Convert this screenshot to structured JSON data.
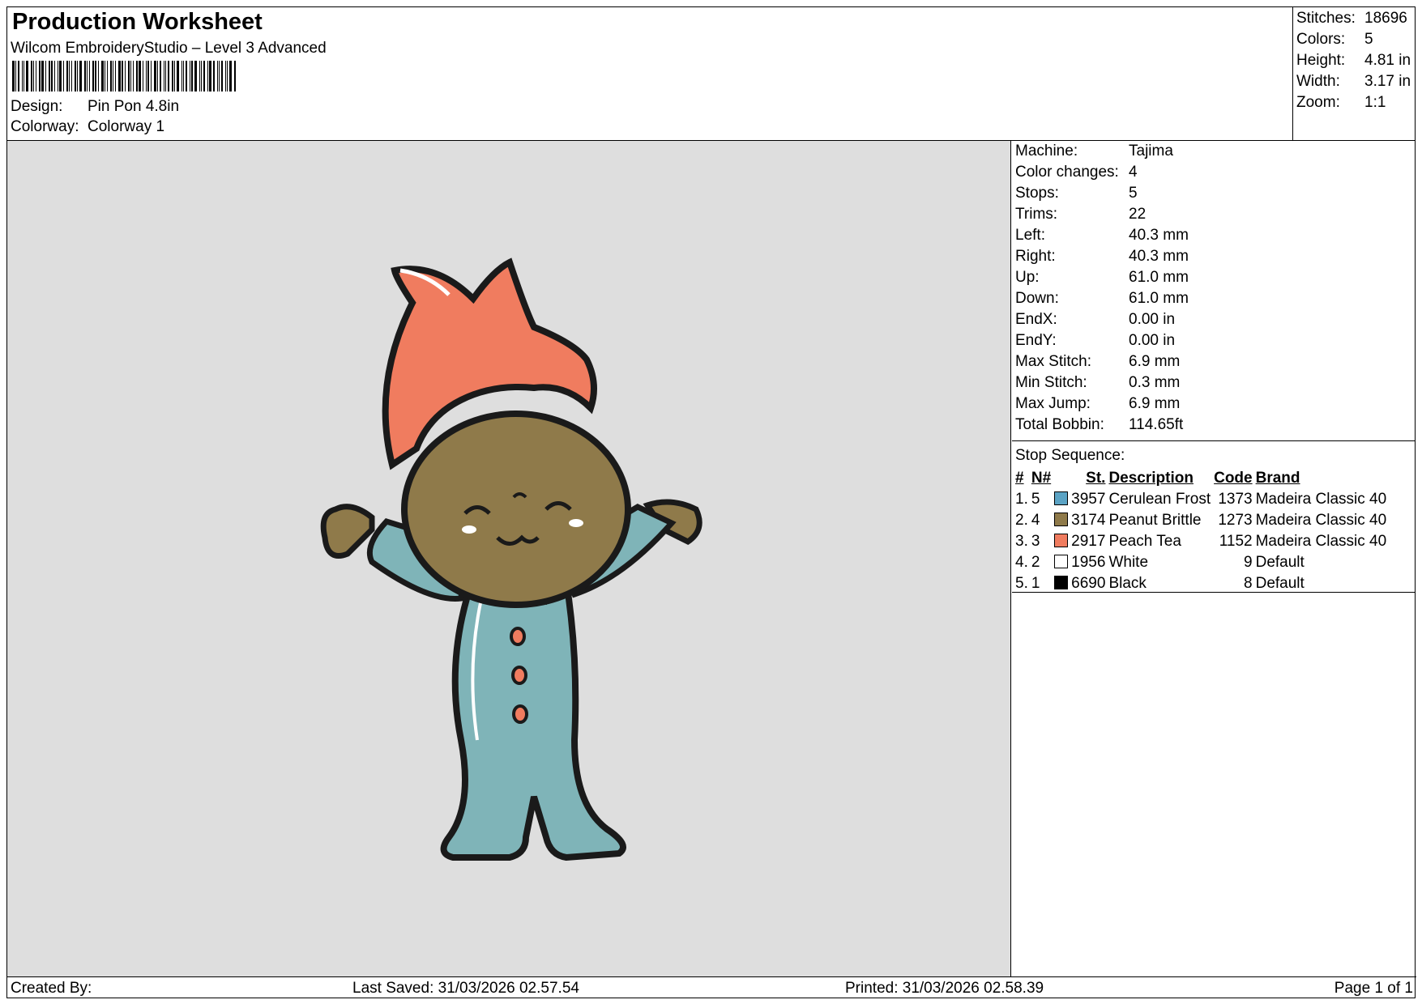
{
  "header": {
    "title": "Production Worksheet",
    "subtitle": "Wilcom EmbroideryStudio – Level 3 Advanced",
    "design_label": "Design:",
    "design_value": "Pin Pon 4.8in",
    "colorway_label": "Colorway:",
    "colorway_value": "Colorway 1"
  },
  "summary": [
    {
      "label": "Stitches:",
      "value": "18696"
    },
    {
      "label": "Colors:",
      "value": "5"
    },
    {
      "label": "Height:",
      "value": "4.81 in"
    },
    {
      "label": "Width:",
      "value": "3.17 in"
    },
    {
      "label": "Zoom:",
      "value": "1:1"
    }
  ],
  "machine": [
    {
      "label": "Machine:",
      "value": "Tajima"
    },
    {
      "label": "Color changes:",
      "value": "4"
    },
    {
      "label": "Stops:",
      "value": "5"
    },
    {
      "label": "Trims:",
      "value": "22"
    },
    {
      "label": "Left:",
      "value": "40.3 mm"
    },
    {
      "label": "Right:",
      "value": "40.3 mm"
    },
    {
      "label": "Up:",
      "value": "61.0 mm"
    },
    {
      "label": "Down:",
      "value": "61.0 mm"
    },
    {
      "label": "EndX:",
      "value": "0.00 in"
    },
    {
      "label": "EndY:",
      "value": "0.00 in"
    },
    {
      "label": "Max Stitch:",
      "value": "6.9 mm"
    },
    {
      "label": "Min Stitch:",
      "value": "0.3 mm"
    },
    {
      "label": "Max Jump:",
      "value": "6.9 mm"
    },
    {
      "label": "Total Bobbin:",
      "value": "114.65ft"
    }
  ],
  "stop_sequence": {
    "title": "Stop Sequence:",
    "headers": {
      "index": "#",
      "n": "N#",
      "st": "St.",
      "description": "Description",
      "code": "Code",
      "brand": "Brand"
    },
    "rows": [
      {
        "index": "1.",
        "n": "5",
        "color": "#5ba3c4",
        "st": "3957",
        "description": "Cerulean Frost",
        "code": "1373",
        "brand": "Madeira Classic 40"
      },
      {
        "index": "2.",
        "n": "4",
        "color": "#8f7a4a",
        "st": "3174",
        "description": "Peanut Brittle",
        "code": "1273",
        "brand": "Madeira Classic 40"
      },
      {
        "index": "3.",
        "n": "3",
        "color": "#f07c5f",
        "st": "2917",
        "description": "Peach Tea",
        "code": "1152",
        "brand": "Madeira Classic 40"
      },
      {
        "index": "4.",
        "n": "2",
        "color": "#ffffff",
        "st": "1956",
        "description": "White",
        "code": "9",
        "brand": "Default"
      },
      {
        "index": "5.",
        "n": "1",
        "color": "#000000",
        "st": "6690",
        "description": "Black",
        "code": "8",
        "brand": "Default"
      }
    ]
  },
  "footer": {
    "created_by": "Created By:",
    "last_saved": "Last Saved: 31/03/2026 02.57.54",
    "printed": "Printed: 31/03/2026 02.58.39",
    "page": "Page 1 of 1"
  }
}
